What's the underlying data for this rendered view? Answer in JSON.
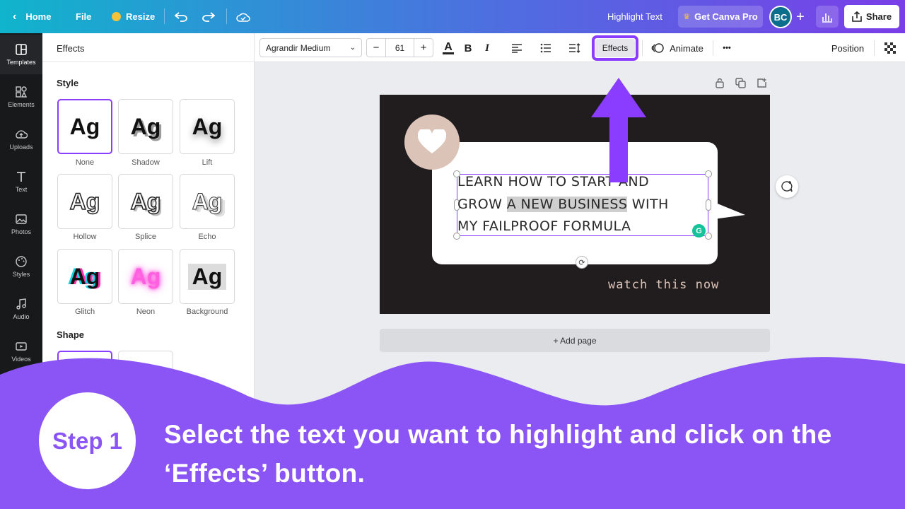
{
  "topbar": {
    "home": "Home",
    "file": "File",
    "resize": "Resize",
    "doc_title": "Highlight Text",
    "get_pro": "Get Canva Pro",
    "avatar": "BC",
    "share": "Share"
  },
  "rail": [
    {
      "label": "Templates",
      "icon": "templates-icon"
    },
    {
      "label": "Elements",
      "icon": "elements-icon"
    },
    {
      "label": "Uploads",
      "icon": "uploads-icon"
    },
    {
      "label": "Text",
      "icon": "text-icon"
    },
    {
      "label": "Photos",
      "icon": "photos-icon"
    },
    {
      "label": "Styles",
      "icon": "styles-icon"
    },
    {
      "label": "Audio",
      "icon": "audio-icon"
    },
    {
      "label": "Videos",
      "icon": "videos-icon"
    }
  ],
  "panel": {
    "title": "Effects",
    "style_label": "Style",
    "shape_label": "Shape",
    "styles": [
      {
        "sample": "Ag",
        "label": "None"
      },
      {
        "sample": "Ag",
        "label": "Shadow"
      },
      {
        "sample": "Ag",
        "label": "Lift"
      },
      {
        "sample": "Ag",
        "label": "Hollow"
      },
      {
        "sample": "Ag",
        "label": "Splice"
      },
      {
        "sample": "Ag",
        "label": "Echo"
      },
      {
        "sample": "Ag",
        "label": "Glitch"
      },
      {
        "sample": "Ag",
        "label": "Neon"
      },
      {
        "sample": "Ag",
        "label": "Background"
      }
    ]
  },
  "toolbar": {
    "font": "Agrandir Medium",
    "minus": "−",
    "size": "61",
    "plus": "+",
    "color_letter": "A",
    "bold": "B",
    "italic": "I",
    "effects": "Effects",
    "animate": "Animate",
    "more": "•••",
    "position": "Position"
  },
  "design": {
    "line1": "LEARN HOW TO START AND",
    "line2_pre": "GROW ",
    "line2_hl": "A NEW BUSINESS",
    "line2_post": " WITH",
    "line3": "MY FAILPROOF FORMULA",
    "watch": "watch this now"
  },
  "add_page": "+ Add page",
  "overlay": {
    "step": "Step 1",
    "instruction": "Select the text you want to highlight and click on the ‘Effects’ button."
  },
  "colors": {
    "accent": "#8b3dff",
    "overlay": "#8b55f5",
    "design_bg": "#211d1e",
    "heart_circle": "#dcc3b8"
  }
}
